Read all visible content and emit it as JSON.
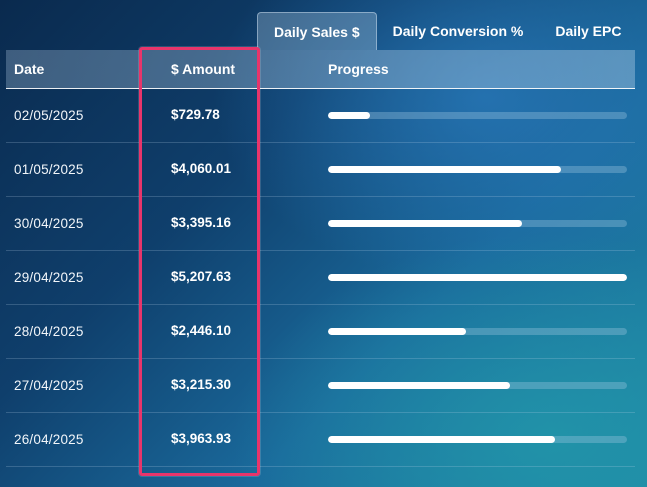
{
  "tabs": [
    {
      "label": "Daily Sales $",
      "active": true
    },
    {
      "label": "Daily Conversion %",
      "active": false
    },
    {
      "label": "Daily EPC",
      "active": false
    }
  ],
  "table": {
    "headers": {
      "date": "Date",
      "amount": "$ Amount",
      "progress": "Progress"
    },
    "rows": [
      {
        "date": "02/05/2025",
        "amount": "$729.78",
        "progress": 0.14
      },
      {
        "date": "01/05/2025",
        "amount": "$4,060.01",
        "progress": 0.78
      },
      {
        "date": "30/04/2025",
        "amount": "$3,395.16",
        "progress": 0.65
      },
      {
        "date": "29/04/2025",
        "amount": "$5,207.63",
        "progress": 1.0
      },
      {
        "date": "28/04/2025",
        "amount": "$2,446.10",
        "progress": 0.46
      },
      {
        "date": "27/04/2025",
        "amount": "$3,215.30",
        "progress": 0.61
      },
      {
        "date": "26/04/2025",
        "amount": "$3,963.93",
        "progress": 0.76
      }
    ]
  },
  "highlight": {
    "color": "#e8356b"
  },
  "colors": {
    "bar_fill": "#ffffff",
    "highlight": "#e8356b"
  }
}
